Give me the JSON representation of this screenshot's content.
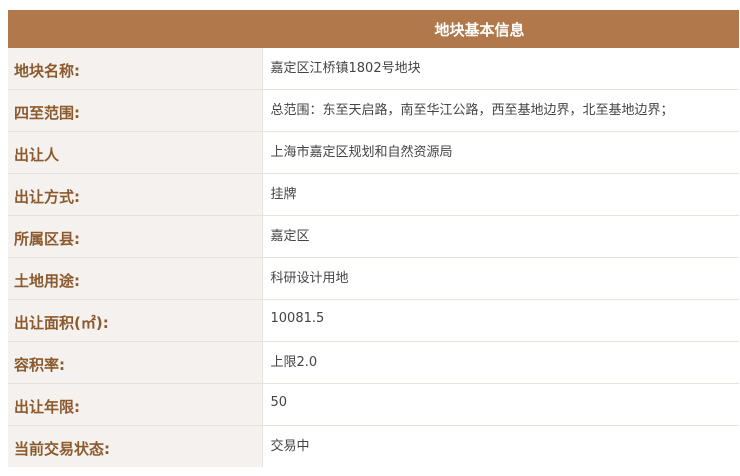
{
  "table": {
    "title": "地块基本信息",
    "rows": [
      {
        "label": "地块名称:",
        "value": "嘉定区江桥镇1802号地块"
      },
      {
        "label": "四至范围:",
        "value": "总范围：东至天启路，南至华江公路，西至基地边界，北至基地边界；"
      },
      {
        "label": "出让人",
        "value": "上海市嘉定区规划和自然资源局"
      },
      {
        "label": "出让方式:",
        "value": "挂牌"
      },
      {
        "label": "所属区县:",
        "value": "嘉定区"
      },
      {
        "label": "土地用途:",
        "value": "科研设计用地"
      },
      {
        "label": "出让面积(㎡):",
        "value": "10081.5"
      },
      {
        "label": "容积率:",
        "value": "上限2.0"
      },
      {
        "label": "出让年限:",
        "value": "50"
      },
      {
        "label": "当前交易状态:",
        "value": "交易中"
      }
    ]
  }
}
